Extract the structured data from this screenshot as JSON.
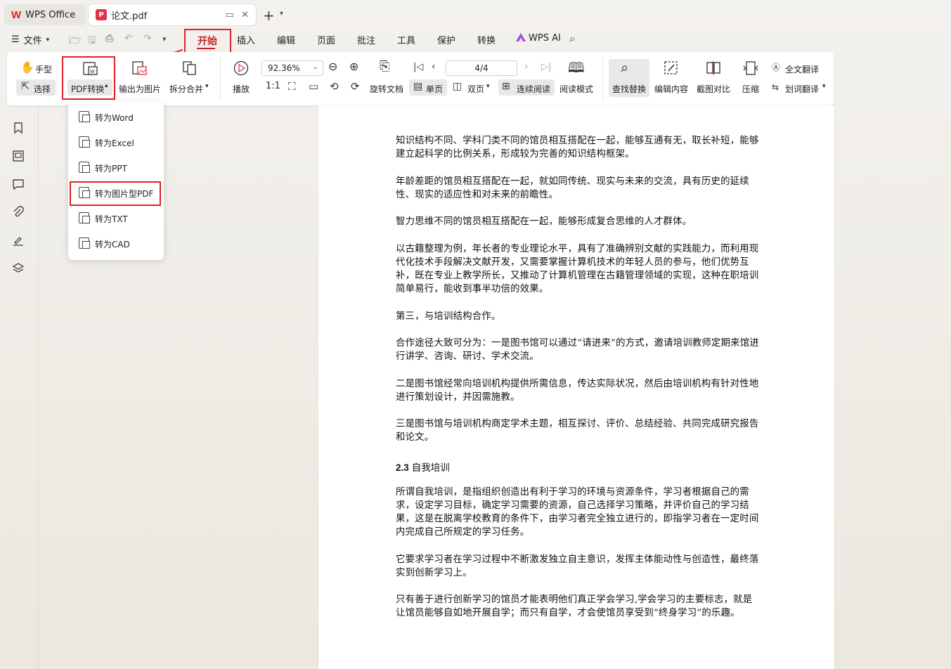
{
  "tabs": {
    "home_label": "WPS Office",
    "doc_label": "论文.pdf"
  },
  "menu": {
    "file_label": "文件",
    "items": [
      "开始",
      "插入",
      "编辑",
      "页面",
      "批注",
      "工具",
      "保护",
      "转换"
    ],
    "wps_ai_label": "WPS AI"
  },
  "ribbon": {
    "hand_label": "手型",
    "select_label": "选择",
    "pdf_convert_label": "PDF转换",
    "export_image_label": "输出为图片",
    "split_merge_label": "拆分合并",
    "play_label": "播放",
    "zoom_value": "92.36%",
    "page_value": "4/4",
    "rotate_doc_label": "旋转文档",
    "single_page_label": "单页",
    "double_page_label": "双页",
    "continuous_label": "连续阅读",
    "reading_mode_label": "阅读模式",
    "find_replace_label": "查找替换",
    "edit_content_label": "编辑内容",
    "compare_label": "截图对比",
    "compress_label": "压缩",
    "full_translate_label": "全文翻译",
    "word_translate_label": "划词翻译"
  },
  "dropdown": {
    "items": [
      "转为Word",
      "转为Excel",
      "转为PPT",
      "转为图片型PDF",
      "转为TXT",
      "转为CAD"
    ]
  },
  "document": {
    "paragraphs": [
      "知识结构不同、学科门类不同的馆员相互搭配在一起，能够互通有无，取长补短，能够建立起科学的比例关系，形成较为完善的知识结构框架。",
      "年龄差距的馆员相互搭配在一起，就如同传统、现实与未来的交流，具有历史的延续性、现实的适应性和对未来的前瞻性。",
      "智力思维不同的馆员相互搭配在一起，能够形成复合思维的人才群体。",
      "以古籍整理为例，年长者的专业理论水平，具有了准确辨别文献的实践能力，而利用现代化技术手段解决文献开发，又需要掌握计算机技术的年轻人员的参与，他们优势互补，既在专业上教学所长，又推动了计算机管理在古籍管理领域的实现，这种在职培训简单易行，能收到事半功倍的效果。",
      "第三，与培训结构合作。",
      "合作途径大致可分为：一是图书馆可以通过“请进来”的方式，邀请培训教师定期来馆进行讲学、咨询、研讨、学术交流。",
      "二是图书馆经常向培训机构提供所需信息，传达实际状况，然后由培训机构有针对性地进行策划设计，并因需施教。",
      "三是图书馆与培训机构商定学术主题，相互探讨、评价、总结经验、共同完成研究报告和论文。"
    ],
    "heading_number": "2.3",
    "heading_text": "自我培训",
    "paragraphs2": [
      "所谓自我培训，是指组织创造出有利于学习的环境与资源条件，学习者根据自己的需求，设定学习目标，确定学习需要的资源，自己选择学习策略，并评价自己的学习结果，这是在脱离学校教育的条件下，由学习者完全独立进行的，即指学习者在一定时间内完成自己所规定的学习任务。",
      "它要求学习者在学习过程中不断激发独立自主意识，发挥主体能动性与创造性，最终落实到创新学习上。",
      "只有善于进行创新学习的馆员才能表明他们真正学会学习,学会学习的主要标志，就是让馆员能够自如地开展自学；而只有自学，才会使馆员享受到“终身学习”的乐趣。"
    ]
  },
  "colors": {
    "accent_red": "#e0202a",
    "brand_red": "#d62b1f"
  }
}
